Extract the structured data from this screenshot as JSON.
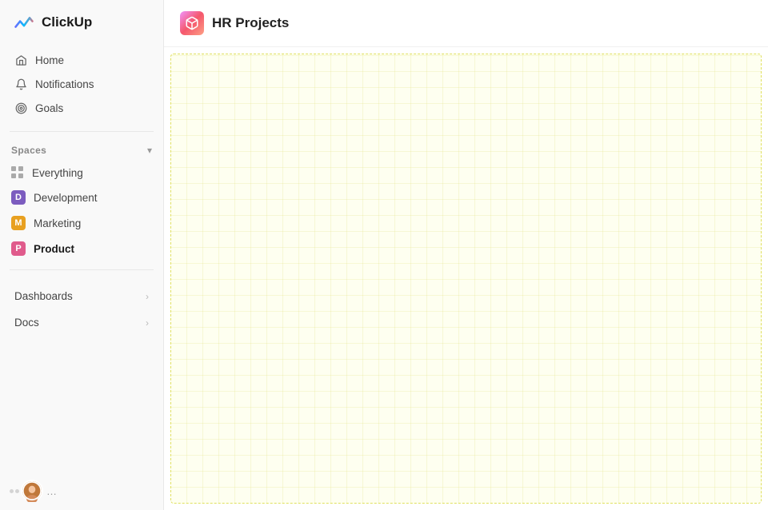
{
  "app": {
    "logo_text": "ClickUp"
  },
  "sidebar": {
    "nav": [
      {
        "label": "Home",
        "icon": "home-icon"
      },
      {
        "label": "Notifications",
        "icon": "bell-icon"
      },
      {
        "label": "Goals",
        "icon": "goals-icon"
      }
    ],
    "spaces_label": "Spaces",
    "spaces": [
      {
        "label": "Everything",
        "type": "grid"
      },
      {
        "label": "Development",
        "type": "avatar",
        "letter": "D",
        "class": "dev"
      },
      {
        "label": "Marketing",
        "type": "avatar",
        "letter": "M",
        "class": "mkt"
      },
      {
        "label": "Product",
        "type": "avatar",
        "letter": "P",
        "class": "prd",
        "active": true
      }
    ],
    "expandables": [
      {
        "label": "Dashboards"
      },
      {
        "label": "Docs"
      }
    ]
  },
  "main": {
    "title": "HR Projects",
    "icon_label": "hr-projects-icon"
  }
}
